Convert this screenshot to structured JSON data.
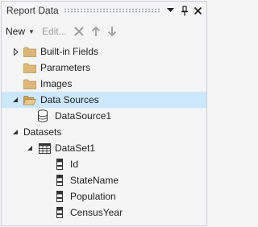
{
  "window": {
    "title": "Report Data",
    "dropdown_icon": "chevron-down-icon",
    "pin_icon": "pin-icon",
    "close_icon": "close-icon"
  },
  "toolbar": {
    "new_label": "New",
    "edit_label": "Edit...",
    "delete_icon": "delete-x-icon",
    "move_up_icon": "arrow-up-icon",
    "move_down_icon": "arrow-down-icon"
  },
  "tree": {
    "builtin_fields": {
      "label": "Built-in Fields",
      "expanded": false,
      "icon": "folder-icon"
    },
    "parameters": {
      "label": "Parameters",
      "icon": "folder-icon"
    },
    "images": {
      "label": "Images",
      "icon": "folder-icon"
    },
    "data_sources": {
      "label": "Data Sources",
      "expanded": true,
      "selected": true,
      "icon": "open-folder-icon",
      "children": [
        {
          "label": "DataSource1",
          "icon": "database-icon"
        }
      ]
    },
    "datasets": {
      "label": "Datasets",
      "expanded": true,
      "children": [
        {
          "label": "DataSet1",
          "expanded": true,
          "icon": "table-icon",
          "fields": [
            {
              "label": "Id",
              "icon": "field-icon"
            },
            {
              "label": "StateName",
              "icon": "field-icon"
            },
            {
              "label": "Population",
              "icon": "field-icon"
            },
            {
              "label": "CensusYear",
              "icon": "field-icon"
            }
          ]
        }
      ]
    }
  },
  "colors": {
    "selection": "#cce8ff",
    "folder": "#dcb67a",
    "panel_bg": "#f5f5f5",
    "border": "#cccedb"
  }
}
